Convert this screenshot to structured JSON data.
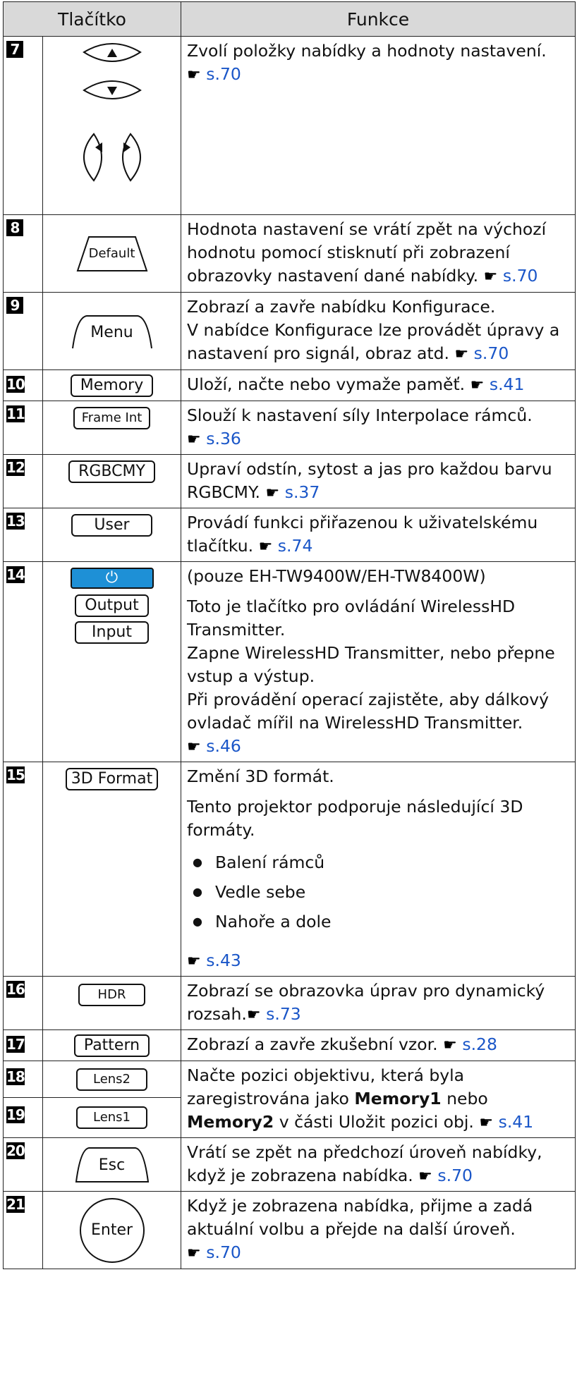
{
  "header": {
    "button_col": "Tlačítko",
    "function_col": "Funkce"
  },
  "ref_icon": "pointing-hand-icon",
  "rows": {
    "r7": {
      "num": "7",
      "text": "Zvolí položky nabídky a hodnoty nastavení.",
      "ref": "s.70"
    },
    "r8": {
      "num": "8",
      "key": "Default",
      "text": "Hodnota nastavení se vrátí zpět na výchozí hodnotu pomocí stisknutí při zobrazení obrazovky nastavení dané nabídky.",
      "ref": "s.70"
    },
    "r9": {
      "num": "9",
      "key": "Menu",
      "line1": "Zobrazí a zavře nabídku Konfigurace.",
      "line2": "V nabídce Konfigurace lze provádět úpravy a nastavení pro signál, obraz atd.",
      "ref": "s.70"
    },
    "r10": {
      "num": "10",
      "key": "Memory",
      "text": "Uloží, načte nebo vymaže paměť.",
      "ref": "s.41"
    },
    "r11": {
      "num": "11",
      "key": "Frame Int",
      "text": "Slouží k nastavení síly Interpolace rámců.",
      "ref": "s.36"
    },
    "r12": {
      "num": "12",
      "key": "RGBCMY",
      "text": "Upraví odstín, sytost a jas pro každou barvu RGBCMY.",
      "ref": "s.37"
    },
    "r13": {
      "num": "13",
      "key": "User",
      "text": "Provádí funkci přiřazenou k uživatelskému tlačítku.",
      "ref": "s.74"
    },
    "r14": {
      "num": "14",
      "key_output": "Output",
      "key_input": "Input",
      "p1": "(pouze EH-TW9400W/EH-TW8400W)",
      "p2": "Toto je tlačítko pro ovládání WirelessHD Transmitter.",
      "p3": "Zapne WirelessHD Transmitter, nebo přepne vstup a výstup.",
      "p4": "Při provádění operací zajistěte, aby dálkový ovladač mířil na WirelessHD Transmitter.",
      "ref": "s.46",
      "power_color": "#1e90d6"
    },
    "r15": {
      "num": "15",
      "key": "3D Format",
      "p1": "Změní 3D formát.",
      "p2": "Tento projektor podporuje následující 3D formáty.",
      "items": [
        "Balení rámců",
        "Vedle sebe",
        "Nahoře a dole"
      ],
      "ref": "s.43"
    },
    "r16": {
      "num": "16",
      "key": "HDR",
      "text": "Zobrazí se obrazovka úprav pro dynamický rozsah.",
      "ref": "s.73"
    },
    "r17": {
      "num": "17",
      "key": "Pattern",
      "text": "Zobrazí a zavře zkušební vzor.",
      "ref": "s.28"
    },
    "r18": {
      "num": "18",
      "key": "Lens2",
      "t1": "Načte pozici objektivu, která byla zaregistrována jako ",
      "b1": "Memory1",
      "t2": " nebo ",
      "b2": "Memory2",
      "t3": " v části Uložit pozici obj.",
      "ref": "s.41"
    },
    "r19": {
      "num": "19",
      "key": "Lens1"
    },
    "r20": {
      "num": "20",
      "key": "Esc",
      "text": "Vrátí se zpět na předchozí úroveň nabídky, když je zobrazena nabídka.",
      "ref": "s.70"
    },
    "r21": {
      "num": "21",
      "key": "Enter",
      "text": "Když je zobrazena nabídka, přijme a zadá aktuální volbu a přejde na další úroveň.",
      "ref": "s.70"
    }
  }
}
